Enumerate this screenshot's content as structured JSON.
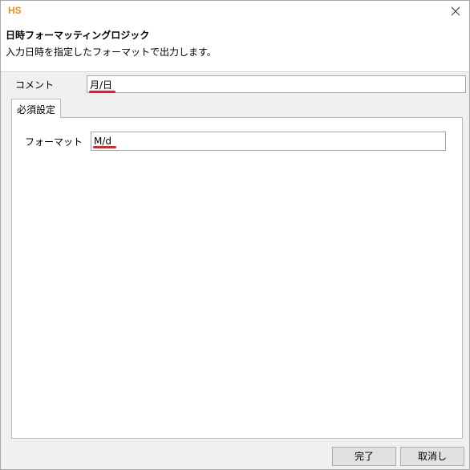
{
  "window": {
    "app_logo": "HS",
    "close_icon": "close-icon"
  },
  "header": {
    "title": "日時フォーマッティングロジック",
    "description": "入力日時を指定したフォーマットで出力します。"
  },
  "comment": {
    "label": "コメント",
    "value": "月/日"
  },
  "tabs": [
    {
      "label": "必須設定",
      "selected": true
    }
  ],
  "required_settings": {
    "format_label": "フォーマット",
    "format_value": "M/d"
  },
  "buttons": {
    "ok_label": "完了",
    "cancel_label": "取消し"
  },
  "colors": {
    "logo": "#f28c1c",
    "annotation_underline": "#e0202a"
  }
}
